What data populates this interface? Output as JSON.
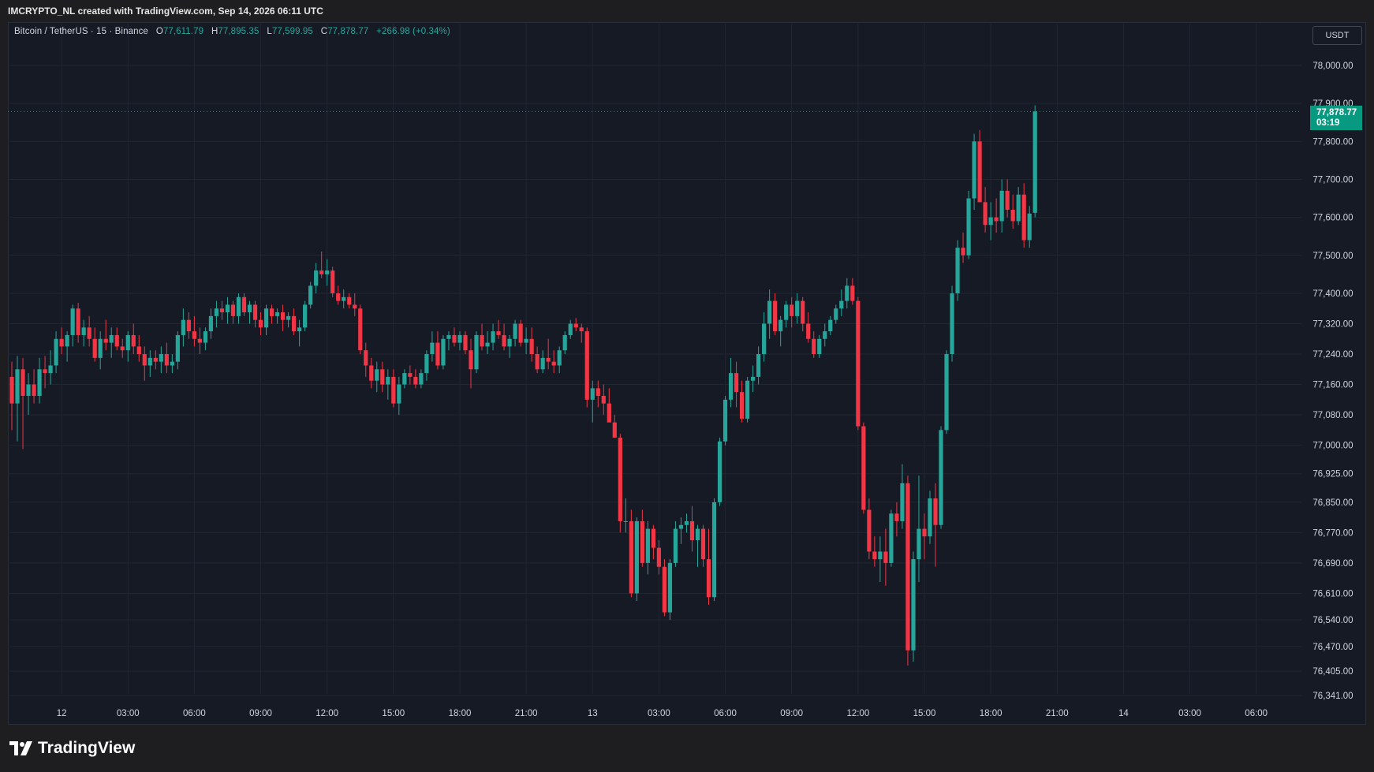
{
  "header": {
    "attribution": "IMCRYPTO_NL created with TradingView.com, Sep 14, 2026 06:11 UTC"
  },
  "legend": {
    "symbol": "Bitcoin / TetherUS · 15 · Binance",
    "o_label": "O",
    "o_value": "77,611.79",
    "h_label": "H",
    "h_value": "77,895.35",
    "l_label": "L",
    "l_value": "77,599.95",
    "c_label": "C",
    "c_value": "77,878.77",
    "change": "+266.98 (+0.34%)"
  },
  "currency_label": "USDT",
  "last_price": {
    "price": "77,878.77",
    "countdown": "03:19"
  },
  "footer": {
    "brand": "TradingView",
    "logo_icon": "tradingview-logo-icon"
  },
  "colors": {
    "up": "#26a69a",
    "down": "#f23645",
    "background": "#161a25",
    "grid": "#222633",
    "axis_text": "#d1d4dc",
    "last_price": "#089981"
  },
  "chart_data": {
    "type": "candlestick",
    "interval_minutes": 15,
    "ylim": [
      76341,
      78000
    ],
    "yticks": [
      {
        "v": 78000,
        "label": "78,000.00"
      },
      {
        "v": 77900,
        "label": "77,900.00"
      },
      {
        "v": 77800,
        "label": "77,800.00"
      },
      {
        "v": 77700,
        "label": "77,700.00"
      },
      {
        "v": 77600,
        "label": "77,600.00"
      },
      {
        "v": 77500,
        "label": "77,500.00"
      },
      {
        "v": 77400,
        "label": "77,400.00"
      },
      {
        "v": 77320,
        "label": "77,320.00"
      },
      {
        "v": 77240,
        "label": "77,240.00"
      },
      {
        "v": 77160,
        "label": "77,160.00"
      },
      {
        "v": 77080,
        "label": "77,080.00"
      },
      {
        "v": 77000,
        "label": "77,000.00"
      },
      {
        "v": 76925,
        "label": "76,925.00"
      },
      {
        "v": 76850,
        "label": "76,850.00"
      },
      {
        "v": 76770,
        "label": "76,770.00"
      },
      {
        "v": 76690,
        "label": "76,690.00"
      },
      {
        "v": 76610,
        "label": "76,610.00"
      },
      {
        "v": 76540,
        "label": "76,540.00"
      },
      {
        "v": 76470,
        "label": "76,470.00"
      },
      {
        "v": 76405,
        "label": "76,405.00"
      },
      {
        "v": 76341,
        "label": "76,341.00"
      }
    ],
    "xticks": [
      {
        "i": 9,
        "label": "12"
      },
      {
        "i": 21,
        "label": "03:00"
      },
      {
        "i": 33,
        "label": "06:00"
      },
      {
        "i": 45,
        "label": "09:00"
      },
      {
        "i": 57,
        "label": "12:00"
      },
      {
        "i": 69,
        "label": "15:00"
      },
      {
        "i": 81,
        "label": "18:00"
      },
      {
        "i": 93,
        "label": "21:00"
      },
      {
        "i": 105,
        "label": "13"
      },
      {
        "i": 117,
        "label": "03:00"
      },
      {
        "i": 129,
        "label": "06:00"
      },
      {
        "i": 141,
        "label": "09:00"
      },
      {
        "i": 153,
        "label": "12:00"
      },
      {
        "i": 165,
        "label": "15:00"
      },
      {
        "i": 177,
        "label": "18:00"
      },
      {
        "i": 189,
        "label": "21:00"
      },
      {
        "i": 201,
        "label": "14"
      },
      {
        "i": 213,
        "label": "03:00"
      },
      {
        "i": 225,
        "label": "06:00"
      }
    ],
    "last_price_value": 77878.77,
    "candles_ohlc": [
      [
        77180,
        77220,
        77040,
        77110
      ],
      [
        77110,
        77235,
        77010,
        77200
      ],
      [
        77200,
        77230,
        76990,
        77130
      ],
      [
        77130,
        77190,
        77080,
        77160
      ],
      [
        77160,
        77200,
        77110,
        77130
      ],
      [
        77130,
        77230,
        77110,
        77200
      ],
      [
        77200,
        77235,
        77150,
        77190
      ],
      [
        77190,
        77250,
        77160,
        77210
      ],
      [
        77210,
        77300,
        77190,
        77280
      ],
      [
        77280,
        77310,
        77240,
        77260
      ],
      [
        77260,
        77300,
        77220,
        77290
      ],
      [
        77290,
        77370,
        77260,
        77360
      ],
      [
        77360,
        77375,
        77270,
        77290
      ],
      [
        77290,
        77330,
        77260,
        77310
      ],
      [
        77310,
        77340,
        77260,
        77280
      ],
      [
        77280,
        77310,
        77220,
        77230
      ],
      [
        77230,
        77300,
        77200,
        77280
      ],
      [
        77280,
        77330,
        77250,
        77270
      ],
      [
        77270,
        77310,
        77230,
        77290
      ],
      [
        77290,
        77310,
        77250,
        77260
      ],
      [
        77260,
        77280,
        77230,
        77250
      ],
      [
        77250,
        77300,
        77220,
        77290
      ],
      [
        77290,
        77320,
        77240,
        77260
      ],
      [
        77260,
        77290,
        77220,
        77240
      ],
      [
        77240,
        77260,
        77170,
        77210
      ],
      [
        77210,
        77250,
        77180,
        77230
      ],
      [
        77230,
        77250,
        77200,
        77220
      ],
      [
        77220,
        77260,
        77190,
        77240
      ],
      [
        77240,
        77270,
        77190,
        77210
      ],
      [
        77210,
        77240,
        77190,
        77220
      ],
      [
        77220,
        77300,
        77200,
        77290
      ],
      [
        77290,
        77360,
        77260,
        77330
      ],
      [
        77330,
        77350,
        77280,
        77300
      ],
      [
        77300,
        77340,
        77260,
        77280
      ],
      [
        77280,
        77310,
        77240,
        77270
      ],
      [
        77270,
        77310,
        77250,
        77300
      ],
      [
        77300,
        77360,
        77280,
        77340
      ],
      [
        77340,
        77380,
        77310,
        77360
      ],
      [
        77360,
        77380,
        77330,
        77350
      ],
      [
        77350,
        77390,
        77320,
        77370
      ],
      [
        77370,
        77380,
        77320,
        77340
      ],
      [
        77340,
        77400,
        77320,
        77390
      ],
      [
        77390,
        77400,
        77340,
        77350
      ],
      [
        77350,
        77380,
        77320,
        77370
      ],
      [
        77370,
        77380,
        77310,
        77330
      ],
      [
        77330,
        77350,
        77290,
        77310
      ],
      [
        77310,
        77370,
        77290,
        77360
      ],
      [
        77360,
        77370,
        77320,
        77340
      ],
      [
        77340,
        77360,
        77320,
        77350
      ],
      [
        77350,
        77370,
        77300,
        77330
      ],
      [
        77330,
        77350,
        77310,
        77340
      ],
      [
        77340,
        77360,
        77290,
        77300
      ],
      [
        77300,
        77330,
        77260,
        77310
      ],
      [
        77310,
        77380,
        77300,
        77370
      ],
      [
        77370,
        77430,
        77360,
        77420
      ],
      [
        77420,
        77480,
        77400,
        77460
      ],
      [
        77460,
        77510,
        77440,
        77450
      ],
      [
        77450,
        77490,
        77420,
        77460
      ],
      [
        77460,
        77470,
        77390,
        77400
      ],
      [
        77400,
        77420,
        77370,
        77380
      ],
      [
        77380,
        77410,
        77360,
        77390
      ],
      [
        77390,
        77400,
        77360,
        77370
      ],
      [
        77370,
        77400,
        77340,
        77360
      ],
      [
        77360,
        77370,
        77240,
        77250
      ],
      [
        77250,
        77270,
        77180,
        77210
      ],
      [
        77210,
        77230,
        77150,
        77170
      ],
      [
        77170,
        77220,
        77140,
        77200
      ],
      [
        77200,
        77220,
        77140,
        77160
      ],
      [
        77160,
        77200,
        77120,
        77180
      ],
      [
        77180,
        77200,
        77100,
        77110
      ],
      [
        77110,
        77180,
        77080,
        77160
      ],
      [
        77160,
        77200,
        77150,
        77190
      ],
      [
        77190,
        77210,
        77160,
        77180
      ],
      [
        77180,
        77200,
        77150,
        77160
      ],
      [
        77160,
        77200,
        77150,
        77190
      ],
      [
        77190,
        77250,
        77170,
        77240
      ],
      [
        77240,
        77300,
        77220,
        77270
      ],
      [
        77270,
        77300,
        77200,
        77210
      ],
      [
        77210,
        77290,
        77200,
        77280
      ],
      [
        77280,
        77300,
        77250,
        77290
      ],
      [
        77290,
        77310,
        77260,
        77270
      ],
      [
        77270,
        77300,
        77250,
        77290
      ],
      [
        77290,
        77300,
        77240,
        77250
      ],
      [
        77250,
        77280,
        77150,
        77200
      ],
      [
        77200,
        77300,
        77190,
        77290
      ],
      [
        77290,
        77320,
        77250,
        77260
      ],
      [
        77260,
        77300,
        77240,
        77270
      ],
      [
        77270,
        77320,
        77250,
        77300
      ],
      [
        77300,
        77330,
        77280,
        77290
      ],
      [
        77290,
        77320,
        77250,
        77260
      ],
      [
        77260,
        77290,
        77230,
        77280
      ],
      [
        77280,
        77330,
        77260,
        77320
      ],
      [
        77320,
        77330,
        77260,
        77270
      ],
      [
        77270,
        77310,
        77240,
        77280
      ],
      [
        77280,
        77310,
        77220,
        77240
      ],
      [
        77240,
        77260,
        77190,
        77200
      ],
      [
        77200,
        77250,
        77190,
        77230
      ],
      [
        77230,
        77280,
        77200,
        77220
      ],
      [
        77220,
        77250,
        77190,
        77210
      ],
      [
        77210,
        77260,
        77190,
        77250
      ],
      [
        77250,
        77300,
        77240,
        77290
      ],
      [
        77290,
        77330,
        77280,
        77320
      ],
      [
        77320,
        77335,
        77300,
        77310
      ],
      [
        77310,
        77320,
        77270,
        77300
      ],
      [
        77300,
        77310,
        77100,
        77120
      ],
      [
        77120,
        77170,
        77060,
        77150
      ],
      [
        77150,
        77170,
        77100,
        77130
      ],
      [
        77130,
        77160,
        77080,
        77110
      ],
      [
        77110,
        77150,
        77070,
        77060
      ],
      [
        77060,
        77080,
        77020,
        77020
      ],
      [
        77020,
        77030,
        76770,
        76800
      ],
      [
        76800,
        76860,
        76770,
        76800
      ],
      [
        76800,
        76830,
        76600,
        76610
      ],
      [
        76610,
        76810,
        76590,
        76800
      ],
      [
        76800,
        76830,
        76680,
        76690
      ],
      [
        76690,
        76800,
        76660,
        76780
      ],
      [
        76780,
        76790,
        76700,
        76730
      ],
      [
        76730,
        76750,
        76660,
        76680
      ],
      [
        76680,
        76700,
        76550,
        76560
      ],
      [
        76560,
        76700,
        76540,
        76690
      ],
      [
        76690,
        76800,
        76680,
        76780
      ],
      [
        76780,
        76810,
        76740,
        76790
      ],
      [
        76790,
        76820,
        76770,
        76800
      ],
      [
        76800,
        76840,
        76720,
        76750
      ],
      [
        76750,
        76790,
        76680,
        76780
      ],
      [
        76780,
        76790,
        76680,
        76700
      ],
      [
        76700,
        76780,
        76580,
        76600
      ],
      [
        76600,
        76860,
        76590,
        76850
      ],
      [
        76850,
        77020,
        76840,
        77010
      ],
      [
        77010,
        77130,
        77000,
        77120
      ],
      [
        77120,
        77230,
        77100,
        77190
      ],
      [
        77190,
        77220,
        77100,
        77140
      ],
      [
        77140,
        77170,
        77060,
        77070
      ],
      [
        77070,
        77180,
        77060,
        77170
      ],
      [
        77170,
        77210,
        77140,
        77180
      ],
      [
        77180,
        77260,
        77160,
        77240
      ],
      [
        77240,
        77350,
        77220,
        77320
      ],
      [
        77320,
        77410,
        77280,
        77380
      ],
      [
        77380,
        77400,
        77290,
        77300
      ],
      [
        77300,
        77340,
        77260,
        77330
      ],
      [
        77330,
        77380,
        77310,
        77370
      ],
      [
        77370,
        77390,
        77310,
        77340
      ],
      [
        77340,
        77400,
        77320,
        77380
      ],
      [
        77380,
        77390,
        77300,
        77320
      ],
      [
        77320,
        77350,
        77270,
        77280
      ],
      [
        77280,
        77300,
        77230,
        77240
      ],
      [
        77240,
        77290,
        77230,
        77280
      ],
      [
        77280,
        77320,
        77260,
        77300
      ],
      [
        77300,
        77340,
        77290,
        77330
      ],
      [
        77330,
        77370,
        77320,
        77360
      ],
      [
        77360,
        77410,
        77340,
        77380
      ],
      [
        77380,
        77440,
        77360,
        77420
      ],
      [
        77420,
        77440,
        77370,
        77380
      ],
      [
        77380,
        77390,
        77040,
        77050
      ],
      [
        77050,
        77060,
        76820,
        76830
      ],
      [
        76830,
        76860,
        76700,
        76720
      ],
      [
        76720,
        76760,
        76680,
        76700
      ],
      [
        76700,
        76760,
        76640,
        76720
      ],
      [
        76720,
        76780,
        76630,
        76690
      ],
      [
        76690,
        76830,
        76680,
        76820
      ],
      [
        76820,
        76850,
        76760,
        76800
      ],
      [
        76800,
        76950,
        76780,
        76900
      ],
      [
        76900,
        76920,
        76420,
        76460
      ],
      [
        76460,
        76720,
        76430,
        76700
      ],
      [
        76700,
        76920,
        76640,
        76780
      ],
      [
        76780,
        76820,
        76700,
        76760
      ],
      [
        76760,
        76880,
        76740,
        76860
      ],
      [
        76860,
        76900,
        76680,
        76790
      ],
      [
        76790,
        77050,
        76780,
        77040
      ],
      [
        77040,
        77250,
        77030,
        77240
      ],
      [
        77240,
        77420,
        77220,
        77400
      ],
      [
        77400,
        77540,
        77380,
        77520
      ],
      [
        77520,
        77560,
        77480,
        77500
      ],
      [
        77500,
        77670,
        77490,
        77650
      ],
      [
        77650,
        77820,
        77620,
        77800
      ],
      [
        77800,
        77830,
        77650,
        77640
      ],
      [
        77640,
        77680,
        77560,
        77580
      ],
      [
        77580,
        77640,
        77540,
        77600
      ],
      [
        77600,
        77650,
        77560,
        77590
      ],
      [
        77590,
        77700,
        77560,
        77670
      ],
      [
        77670,
        77700,
        77600,
        77620
      ],
      [
        77620,
        77660,
        77570,
        77590
      ],
      [
        77590,
        77680,
        77580,
        77660
      ],
      [
        77660,
        77690,
        77520,
        77540
      ],
      [
        77540,
        77630,
        77520,
        77610
      ],
      [
        77612,
        77895,
        77600,
        77879
      ]
    ]
  }
}
